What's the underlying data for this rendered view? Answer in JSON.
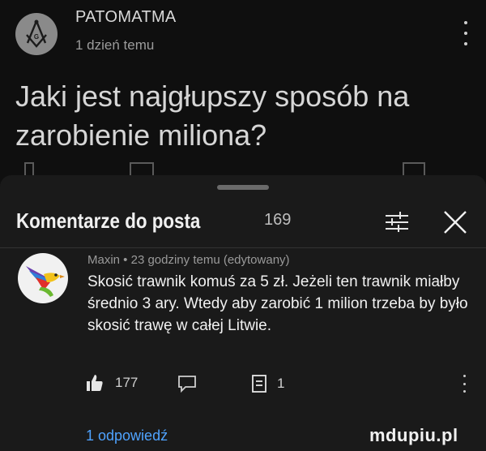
{
  "post": {
    "channel_name": "PATOMATMA",
    "time": "1 dzień temu",
    "title": "Jaki jest najgłupszy sposób na zarobienie miliona?",
    "avatar_icon": "masonic-compass-icon"
  },
  "comments_sheet": {
    "title": "Komentarze do posta",
    "count": "169",
    "sort_icon": "sort-icon",
    "close_icon": "close-icon"
  },
  "comment": {
    "meta": "Maxin • 23 godziny temu (edytowany)",
    "text": "Skosić trawnik komuś za 5 zł. Jeżeli ten trawnik miałby średnio 3 ary.  Wtedy aby zarobić 1 milion trzeba by było skosić trawę w całej Litwie.",
    "likes": "177",
    "saves": "1",
    "avatar_icon": "bird-avatar-icon"
  },
  "replies_label": "1 odpowiedź",
  "watermark": "mdupiu.pl",
  "colors": {
    "background": "#0f0f0f",
    "sheet": "#1a1a1a",
    "link": "#4fa3ff"
  }
}
